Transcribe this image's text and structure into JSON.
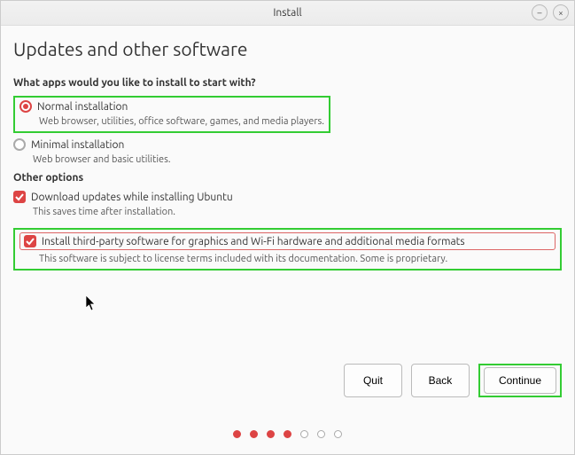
{
  "window": {
    "title": "Install"
  },
  "heading": "Updates and other software",
  "sections": {
    "apps": {
      "question": "What apps would you like to install to start with?",
      "normal": {
        "label": "Normal installation",
        "desc": "Web browser, utilities, office software, games, and media players.",
        "selected": true
      },
      "minimal": {
        "label": "Minimal installation",
        "desc": "Web browser and basic utilities.",
        "selected": false
      }
    },
    "other": {
      "heading": "Other options",
      "updates": {
        "label": "Download updates while installing Ubuntu",
        "desc": "This saves time after installation.",
        "checked": true
      },
      "thirdparty": {
        "label": "Install third-party software for graphics and Wi-Fi hardware and additional media formats",
        "desc": "This software is subject to license terms included with its documentation. Some is proprietary.",
        "checked": true
      }
    }
  },
  "buttons": {
    "quit": "Quit",
    "back": "Back",
    "continue": "Continue"
  },
  "progress": {
    "total": 7,
    "current": 4
  },
  "colors": {
    "accent": "#d44",
    "highlight": "#3c3"
  }
}
